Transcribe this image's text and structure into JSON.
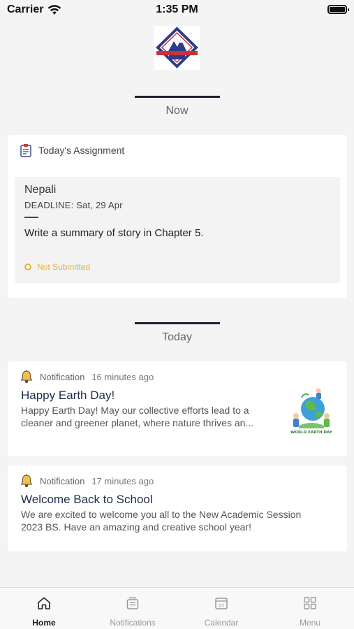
{
  "status_bar": {
    "carrier": "Carrier",
    "time": "1:35 PM"
  },
  "sections": {
    "now": "Now",
    "today": "Today"
  },
  "assignment": {
    "header": "Today's Assignment",
    "subject": "Nepali",
    "deadline": "DEADLINE: Sat, 29 Apr",
    "task": "Write a summary of story in Chapter 5.",
    "status": "Not Submitted",
    "status_color": "#e8b63a"
  },
  "notifications": [
    {
      "type": "Notification",
      "ago": "16 minutes ago",
      "title": "Happy Earth Day!",
      "body_line1": "Happy Earth Day! May our collective efforts lead to a",
      "body_line2": "cleaner and greener planet, where nature thrives an...",
      "thumb_text": "WORLD EARTH DAY"
    },
    {
      "type": "Notification",
      "ago": "17 minutes ago",
      "title": "Welcome Back to School",
      "body_line1": "We are excited to welcome you all to the New Academic Session",
      "body_line2": "2023 BS. Have an amazing and creative school year!"
    }
  ],
  "tabs": [
    {
      "label": "Home",
      "icon": "home-icon",
      "active": true
    },
    {
      "label": "Notifications",
      "icon": "notifications-icon",
      "active": false
    },
    {
      "label": "Calendar",
      "icon": "calendar-icon",
      "active": false,
      "date": "23"
    },
    {
      "label": "Menu",
      "icon": "grid-icon",
      "active": false
    }
  ]
}
